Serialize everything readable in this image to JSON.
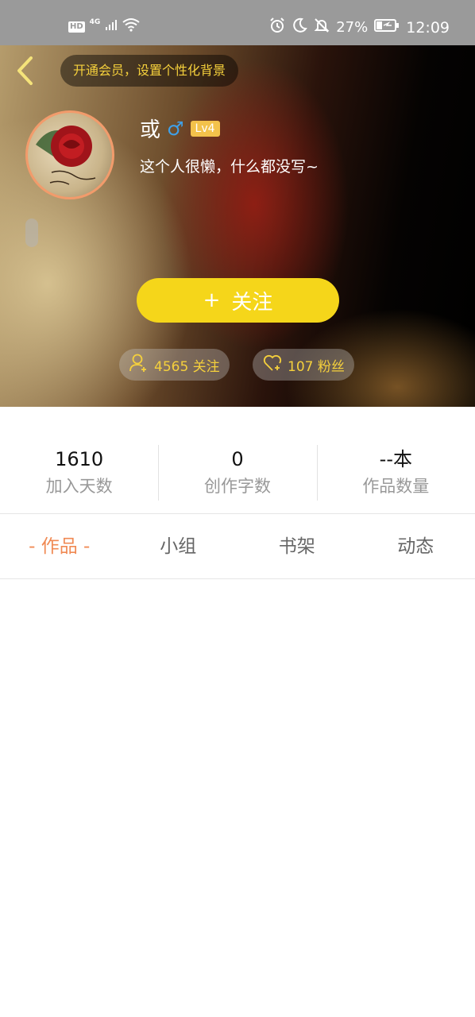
{
  "status_bar": {
    "hd": "HD",
    "network": "4G",
    "battery_percent": "27%",
    "time": "12:09",
    "icons": [
      "signal-icon",
      "wifi-icon",
      "alarm-icon",
      "moon-icon",
      "bell-off-icon",
      "battery-charging-icon"
    ]
  },
  "header": {
    "back_icon": "chevron-left-icon",
    "vip_banner": "开通会员，设置个性化背景"
  },
  "profile": {
    "username": "或",
    "gender_symbol": "♂",
    "level": "Lv4",
    "bio": "这个人很懒，什么都没写~",
    "follow_button": {
      "plus": "+",
      "label": "关注"
    },
    "following_stat": "4565 关注",
    "fans_stat": "107 粉丝"
  },
  "stats": [
    {
      "value": "1610",
      "label": "加入天数"
    },
    {
      "value": "0",
      "label": "创作字数"
    },
    {
      "value": "--本",
      "label": "作品数量"
    }
  ],
  "tabs": [
    {
      "label": "- 作品 -",
      "active": true
    },
    {
      "label": "小组",
      "active": false
    },
    {
      "label": "书架",
      "active": false
    },
    {
      "label": "动态",
      "active": false
    }
  ],
  "colors": {
    "accent_yellow": "#f5d61a",
    "active_tab": "#f08a54",
    "gender_blue": "#3fa0e8",
    "level_badge": "#f3c24b"
  }
}
